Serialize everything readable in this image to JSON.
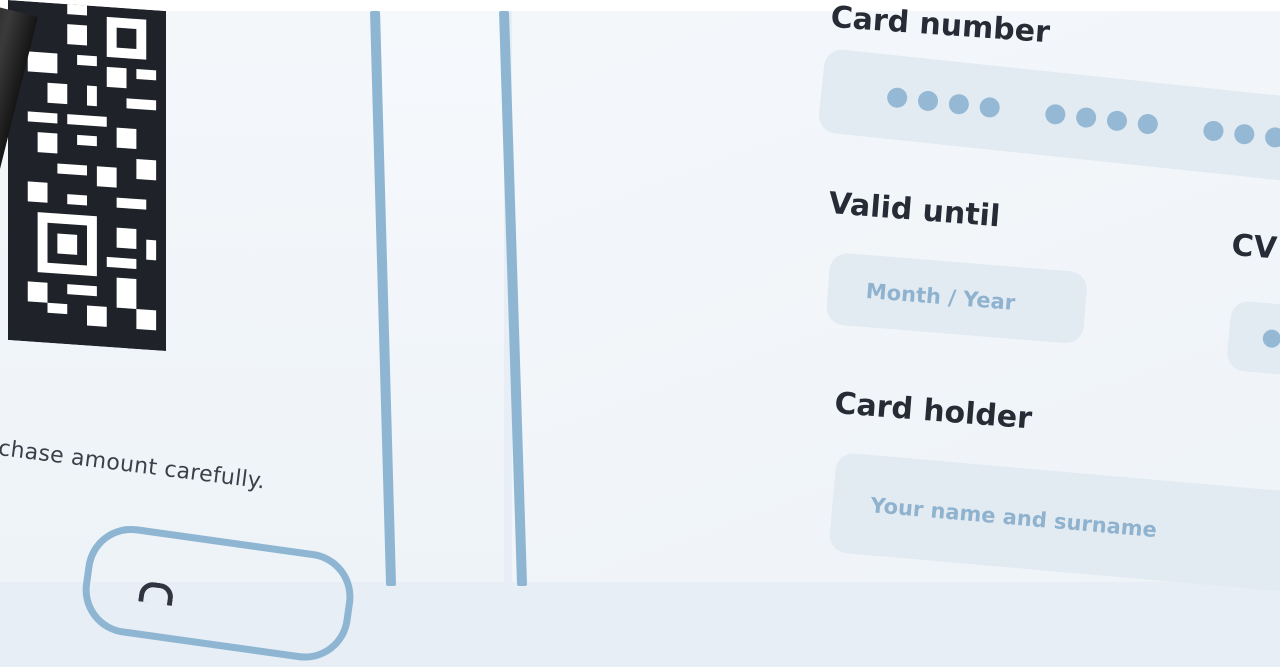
{
  "left_panel": {
    "instruction_text": "chase amount carefully."
  },
  "form": {
    "card_number": {
      "label": "Card number",
      "mask_groups": [
        4,
        4,
        4
      ]
    },
    "valid_until": {
      "label": "Valid until",
      "placeholder": "Month / Year"
    },
    "cvv": {
      "label": "CV",
      "mask_dots": 1
    },
    "card_holder": {
      "label": "Card holder",
      "placeholder": "Your name and surname"
    }
  },
  "colors": {
    "background": "#e7eef5",
    "accent_border": "#8eb6d3",
    "field_bg": "#e2eaf2",
    "placeholder": "#8fb3cf",
    "label_text": "#262b36"
  }
}
